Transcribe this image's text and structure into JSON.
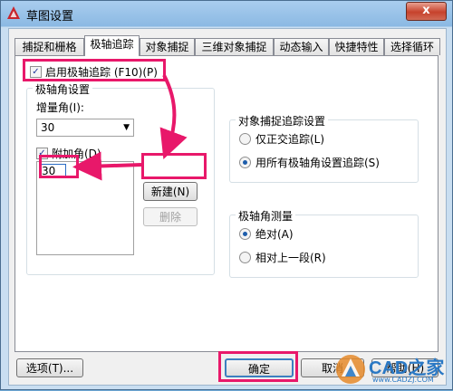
{
  "window": {
    "title": "草图设置",
    "close_label": "x"
  },
  "tabs": [
    "捕捉和栅格",
    "极轴追踪",
    "对象捕捉",
    "三维对象捕捉",
    "动态输入",
    "快捷特性",
    "选择循环"
  ],
  "polar": {
    "enable_label": "启用极轴追踪 (F10)(P)",
    "enabled": true,
    "angle_group_title": "极轴角设置",
    "increment_label": "增量角(I):",
    "increment_value": "30",
    "additional_label": "附加角(D)",
    "additional_checked": true,
    "additional_input_value": "30",
    "new_label": "新建(N)",
    "delete_label": "删除"
  },
  "snap_tracking": {
    "group_title": "对象捕捉追踪设置",
    "option1": "仅正交追踪(L)",
    "option2": "用所有极轴角设置追踪(S)",
    "selected": "option2"
  },
  "measurement": {
    "group_title": "极轴角测量",
    "option1": "绝对(A)",
    "option2": "相对上一段(R)",
    "selected": "option1"
  },
  "footer": {
    "options_label": "选项(T)...",
    "ok_label": "确定",
    "cancel_label": "取消",
    "help_label": "帮助(H)"
  },
  "watermark": {
    "brand": "CAD之家",
    "url": "www.CADZJ.COM"
  },
  "colors": {
    "highlight": "#e8186a",
    "title_bar": "#8bb9e3"
  }
}
